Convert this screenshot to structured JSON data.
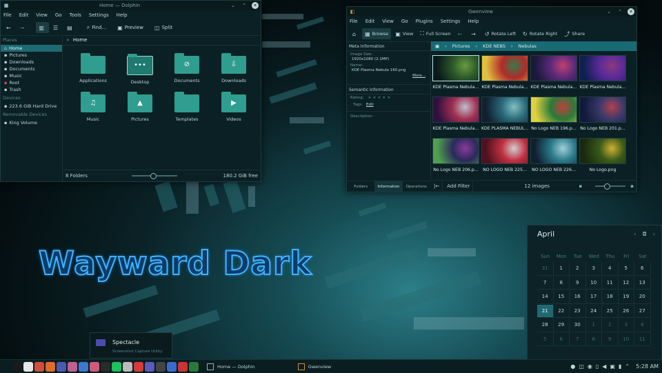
{
  "wallpaper": {
    "brand_text": "Wayward Dark"
  },
  "dolphin": {
    "title": "Home — Dolphin",
    "menu": [
      "File",
      "Edit",
      "View",
      "Go",
      "Tools",
      "Settings",
      "Help"
    ],
    "toolbar": {
      "find": "Find...",
      "preview": "Preview",
      "split": "Split"
    },
    "places": {
      "header": "Places",
      "items": [
        "Home",
        "Pictures",
        "Downloads",
        "Documents",
        "Music",
        "Root",
        "Trash"
      ],
      "devices_header": "Devices",
      "devices": [
        "223.6 GiB Hard Drive"
      ],
      "removable_header": "Removable Devices",
      "removable": [
        "King Volume"
      ]
    },
    "breadcrumb": "Home",
    "folders": [
      {
        "label": "Applications",
        "icon": "folder-icon"
      },
      {
        "label": "Desktop",
        "icon": "desktop-folder-icon"
      },
      {
        "label": "Documents",
        "icon": "paperclip-icon"
      },
      {
        "label": "Downloads",
        "icon": "download-icon"
      },
      {
        "label": "Music",
        "icon": "music-note-icon"
      },
      {
        "label": "Pictures",
        "icon": "image-icon"
      },
      {
        "label": "Templates",
        "icon": "folder-icon"
      },
      {
        "label": "Videos",
        "icon": "video-camera-icon"
      }
    ],
    "status": {
      "count": "8 Folders",
      "free": "180.2 GiB free",
      "zoom_fraction": 0.45
    }
  },
  "gwenview": {
    "title": "Gwenview",
    "menu": [
      "File",
      "Edit",
      "View",
      "Go",
      "Plugins",
      "Settings",
      "Help"
    ],
    "toolbar": {
      "browse": "Browse",
      "view": "View",
      "fullscreen": "Full Screen",
      "rotate_left": "Rotate Left",
      "rotate_right": "Rotate Right",
      "share": "Share"
    },
    "meta": {
      "header": "Meta Information",
      "size_label": "Image Size:",
      "size_value": "1920x1080 (2.1MP)",
      "name_label": "Name:",
      "name_value": "KDE Plasma Nebula 160.png",
      "more": "More...",
      "semantic_header": "Semantic Information",
      "rating_label": "Rating:",
      "tags_label": "Tags:",
      "tags_edit": "Edit",
      "description_label": "Description:"
    },
    "tabs": [
      "Folders",
      "Information",
      "Operations"
    ],
    "breadcrumb": [
      "Pictures",
      "KDE NEBS",
      "Nebulas"
    ],
    "thumbnails": [
      {
        "caption": "KDE Plasma Nebula...",
        "colors": [
          "#2c5a2a",
          "#6a9a3f",
          "#0a1a1a"
        ]
      },
      {
        "caption": "KDE Plasma Nebula...",
        "colors": [
          "#b12a2a",
          "#3a7a4a",
          "#e0c040"
        ]
      },
      {
        "caption": "KDE Plasma Nebula...",
        "colors": [
          "#5a2a7a",
          "#c04070",
          "#1a1a3a"
        ]
      },
      {
        "caption": "KDE Plasma Nebula...",
        "colors": [
          "#5a2a9a",
          "#8a3a7a",
          "#102050"
        ]
      },
      {
        "caption": "KDE Plasma Nebula...",
        "colors": [
          "#a03050",
          "#c0c0d0",
          "#301040"
        ]
      },
      {
        "caption": "KDE PLASMA NEBUL...",
        "colors": [
          "#2a6a7a",
          "#80c0c0",
          "#102030"
        ]
      },
      {
        "caption": "No Logo NEB 196.p...",
        "colors": [
          "#2a7a3a",
          "#c04040",
          "#e0d040"
        ]
      },
      {
        "caption": "No Logo NEB 201.p...",
        "colors": [
          "#3a3a6a",
          "#b04050",
          "#101a3a"
        ]
      },
      {
        "caption": "No Logo NEB 206.p...",
        "colors": [
          "#2a2a5a",
          "#8a3a9a",
          "#50a050"
        ]
      },
      {
        "caption": "NO LOGO NEB 225...",
        "colors": [
          "#c03040",
          "#d0d0d0",
          "#501020"
        ]
      },
      {
        "caption": "NO LOGO NEB 226...",
        "colors": [
          "#2a7a8a",
          "#a0d0d8",
          "#102030"
        ]
      },
      {
        "caption": "No Logo.png",
        "colors": [
          "#3a5a1a",
          "#d0b030",
          "#1a2a10"
        ]
      }
    ],
    "selected_index": 0,
    "status": {
      "add_filter": "Add Filter",
      "count": "12 images",
      "zoom_fraction": 0.35
    }
  },
  "calendar": {
    "month": "April",
    "weekdays": [
      "Sun",
      "Mon",
      "Tue",
      "Wed",
      "Thu",
      "Fri",
      "Sat"
    ],
    "weeks": [
      [
        "31",
        "1",
        "2",
        "3",
        "4",
        "5",
        "6"
      ],
      [
        "7",
        "8",
        "9",
        "10",
        "11",
        "12",
        "13"
      ],
      [
        "14",
        "15",
        "16",
        "17",
        "18",
        "19",
        "20"
      ],
      [
        "21",
        "22",
        "23",
        "24",
        "25",
        "26",
        "27"
      ],
      [
        "28",
        "29",
        "30",
        "1",
        "2",
        "3",
        "4"
      ],
      [
        "5",
        "6",
        "7",
        "8",
        "9",
        "10",
        "11"
      ]
    ],
    "today": "21"
  },
  "notification": {
    "title": "Spectacle",
    "subtitle": "Screenshot Capture Utility"
  },
  "taskbar": {
    "tasks": [
      "Home — Dolphin",
      "Gwenview"
    ],
    "clock": "5:28 AM",
    "launchers": [
      {
        "icon": "app-launcher-icon",
        "color": "#0a1d20"
      },
      {
        "icon": "terminal-icon",
        "color": "#1a1a1a"
      },
      {
        "icon": "file-manager-icon",
        "color": "#e6e6e6"
      },
      {
        "icon": "chrome-icon",
        "color": "#d44c3a"
      },
      {
        "icon": "firefox-icon",
        "color": "#e06b2a"
      },
      {
        "icon": "kde-connect-icon",
        "color": "#4a5ab0"
      },
      {
        "icon": "palette-icon",
        "color": "#c06090"
      },
      {
        "icon": "chromium-icon",
        "color": "#3a7ad0"
      },
      {
        "icon": "kate-icon",
        "color": "#d05a7a"
      },
      {
        "icon": "dark-mode-icon",
        "color": "#2a2a2a"
      },
      {
        "icon": "spotify-icon",
        "color": "#1ec15c"
      },
      {
        "icon": "calculator-icon",
        "color": "#bbbbbb"
      },
      {
        "icon": "camera-icon",
        "color": "#d83a3a"
      },
      {
        "icon": "spectacle-icon",
        "color": "#5a5ac0"
      },
      {
        "icon": "headphones-icon",
        "color": "#444444"
      },
      {
        "icon": "screen-icon",
        "color": "#3a6ad0"
      },
      {
        "icon": "tools-icon",
        "color": "#cc3333"
      },
      {
        "icon": "plant-icon",
        "color": "#2a7a3a"
      }
    ]
  }
}
